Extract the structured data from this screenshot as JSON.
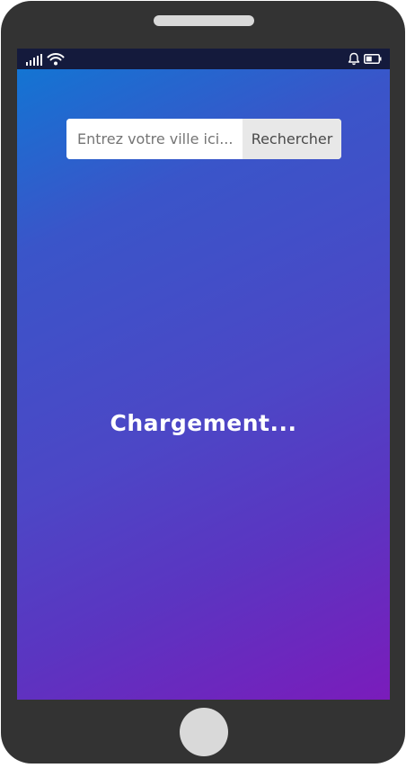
{
  "search": {
    "placeholder": "Entrez votre ville ici...",
    "value": "",
    "button_label": "Rechercher"
  },
  "status": {
    "loading_text": "Chargement..."
  },
  "status_bar": {
    "icons": [
      "signal-icon",
      "wifi-icon",
      "bell-icon",
      "battery-icon"
    ]
  },
  "theme": {
    "gradient_start": "#0f78d4",
    "gradient_end": "#7a1cbb",
    "frame_color": "#333333",
    "status_bar_color": "#141a3c"
  }
}
